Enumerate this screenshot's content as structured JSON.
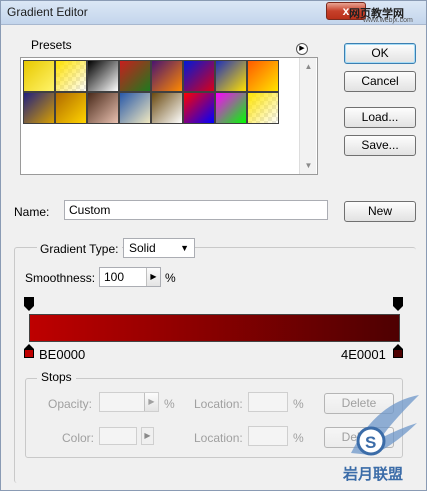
{
  "window": {
    "title": "Gradient Editor",
    "brand": "网页教学网",
    "brand_sub": "www.webjx.com",
    "close_glyph": "x"
  },
  "buttons": {
    "ok": "OK",
    "cancel": "Cancel",
    "load": "Load...",
    "save": "Save...",
    "new": "New"
  },
  "presets": {
    "label": "Presets",
    "menu_glyph": "▶",
    "scroll_up": "▲",
    "scroll_down": "▼",
    "swatches": [
      [
        "#e8c800",
        "#fff46a"
      ],
      [
        "#ffe100",
        "checker"
      ],
      [
        "#000000",
        "#ffffff"
      ],
      [
        "#c81e1e",
        "#1e7a1e"
      ],
      [
        "#4a1470",
        "#ff8a00"
      ],
      [
        "#0018d8",
        "#d80018"
      ],
      [
        "#2030b8",
        "#ffe000"
      ],
      [
        "#ff5a00",
        "#ffe400"
      ],
      [
        "#202080",
        "#d8a000"
      ],
      [
        "#b06a00",
        "#ffd400"
      ],
      [
        "#4a2a1a",
        "#e8c0b0"
      ],
      [
        "#2858a8",
        "#f0e8c0"
      ],
      [
        "#6a4a10",
        "#ffffff"
      ],
      [
        "#ff0000",
        "#0000ff"
      ],
      [
        "#ff00ff",
        "#00ff00"
      ],
      [
        "#ffe400",
        "checker"
      ]
    ]
  },
  "name_field": {
    "label": "Name:",
    "value": "Custom"
  },
  "gradient_type": {
    "label": "Gradient Type:",
    "value": "Solid"
  },
  "smoothness": {
    "label": "Smoothness:",
    "value": "100",
    "unit": "%"
  },
  "gradient": {
    "start_color": "#BE0000",
    "end_color": "#4E0001",
    "start_label": "BE0000",
    "end_label": "4E0001"
  },
  "stops": {
    "label": "Stops",
    "opacity_label": "Opacity:",
    "opacity_unit": "%",
    "opacity_location_label": "Location:",
    "opacity_location_unit": "%",
    "opacity_delete": "Delete",
    "color_label": "Color:",
    "color_location_label": "Location:",
    "color_location_unit": "%",
    "color_delete": "Delete"
  },
  "watermark": {
    "text": "岩月联盟"
  }
}
